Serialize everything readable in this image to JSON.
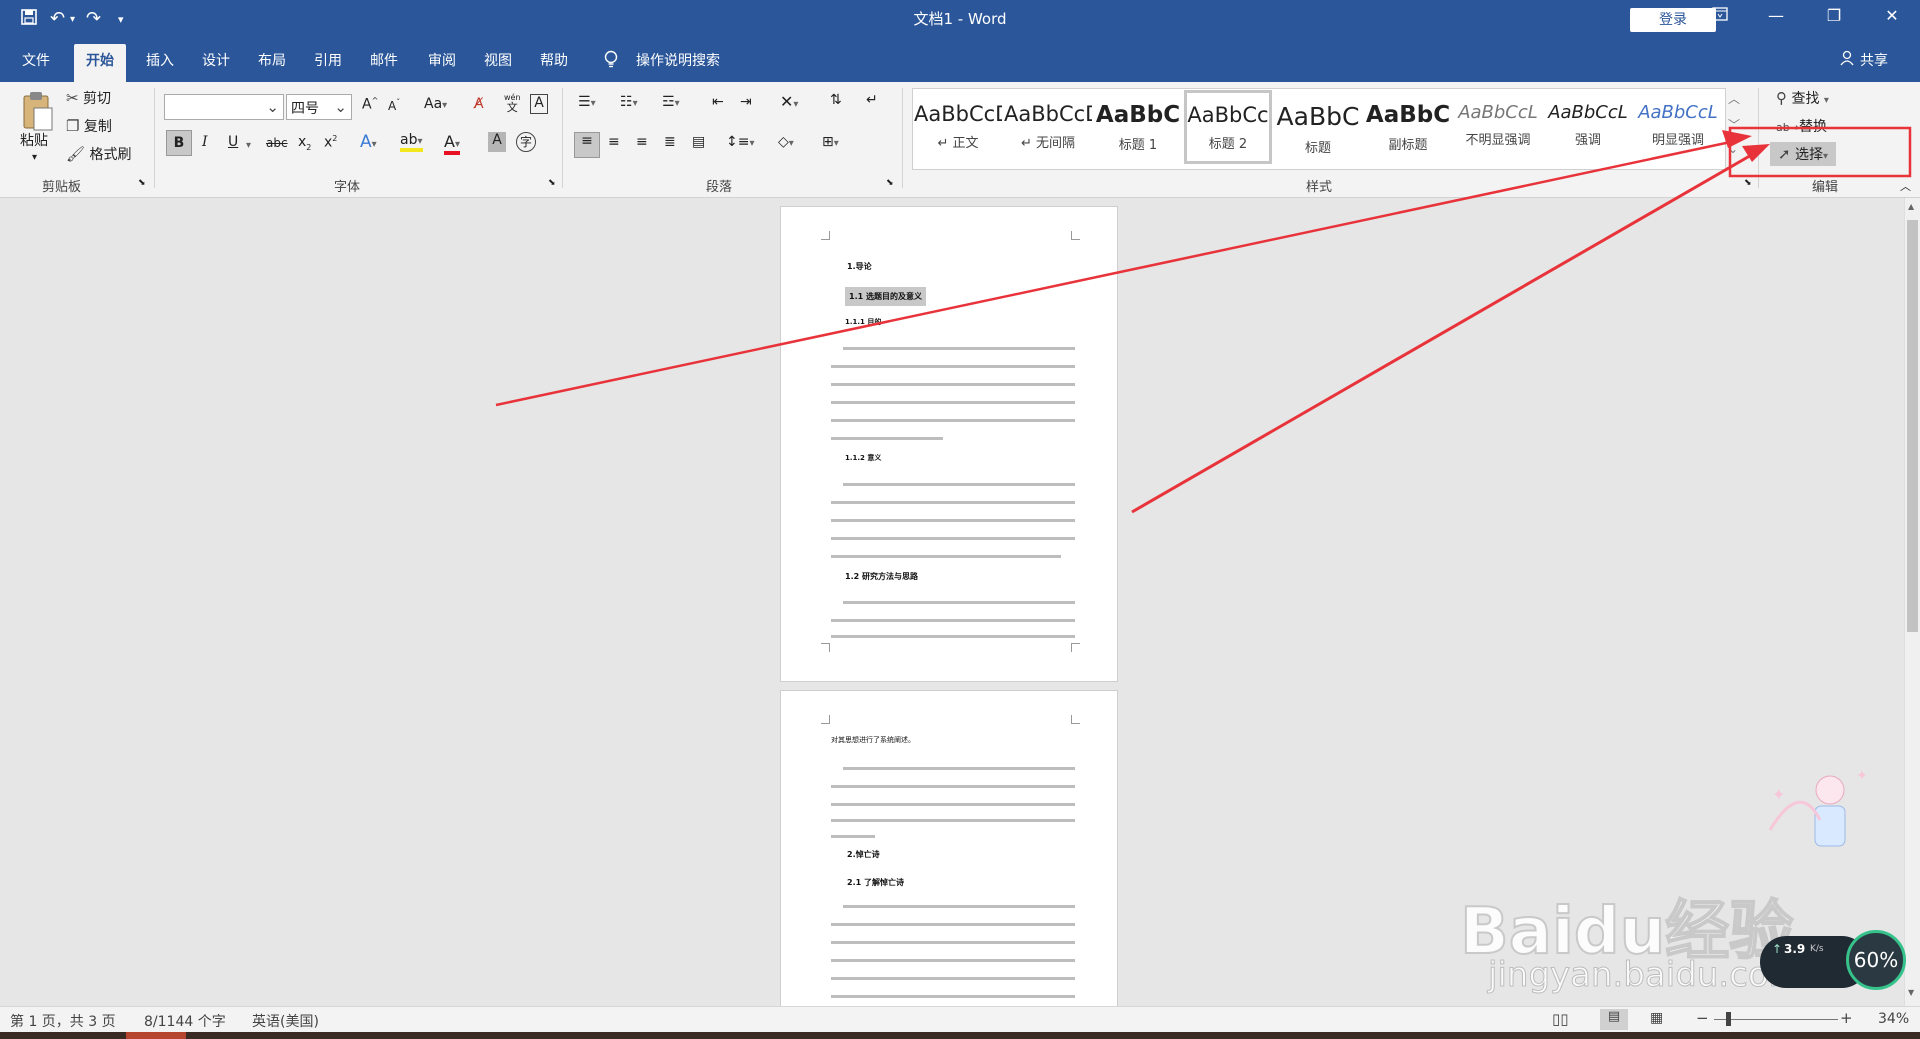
{
  "window": {
    "title": "文档1 - Word",
    "login": "登录"
  },
  "quick_access": {
    "save_icon": "save-icon",
    "undo_icon": "undo-icon",
    "redo_icon": "redo-icon",
    "customize_icon": "chevron-down-icon"
  },
  "menu": {
    "tabs": [
      "文件",
      "开始",
      "插入",
      "设计",
      "布局",
      "引用",
      "邮件",
      "审阅",
      "视图",
      "帮助"
    ],
    "tell_me": "操作说明搜索",
    "share": "共享"
  },
  "clipboard": {
    "paste": "粘贴",
    "cut": "剪切",
    "copy": "复制",
    "format_painter": "格式刷",
    "label": "剪贴板"
  },
  "font": {
    "name": "",
    "size": "四号",
    "case_label": "Aa",
    "label": "字体",
    "wen": "wén",
    "wen_char": "文"
  },
  "paragraph": {
    "label": "段落"
  },
  "styles": {
    "label": "样式",
    "items": [
      {
        "sample": "AaBbCcD",
        "name": "↵ 正文"
      },
      {
        "sample": "AaBbCcD",
        "name": "↵ 无间隔"
      },
      {
        "sample": "AaBbC",
        "name": "标题 1"
      },
      {
        "sample": "AaBbCc",
        "name": "标题 2"
      },
      {
        "sample": "AaBbC",
        "name": "标题"
      },
      {
        "sample": "AaBbC",
        "name": "副标题"
      },
      {
        "sample": "AaBbCcL",
        "name": "不明显强调"
      },
      {
        "sample": "AaBbCcL",
        "name": "强调"
      },
      {
        "sample": "AaBbCcL",
        "name": "明显强调"
      }
    ]
  },
  "editing": {
    "find": "查找",
    "replace": "替换",
    "select": "选择",
    "label": "编辑"
  },
  "document": {
    "page1": {
      "h1": "1.导论",
      "h2_selected": "1.1 选题目的及意义",
      "h3a": "1.1.1 目的",
      "h3b": "1.1.2 意义",
      "h2b": "1.2 研究方法与思路"
    },
    "page2": {
      "first_line": "对其思想进行了系统阐述。",
      "h1": "2.悼亡诗",
      "h2": "2.1 了解悼亡诗"
    }
  },
  "status": {
    "page": "第 1 页，共 3 页",
    "words": "8/1144 个字",
    "lang": "英语(美国)",
    "zoom": "34%"
  },
  "watermark": {
    "speed": "3.9",
    "speed_unit": "K/s",
    "percent": "60%",
    "brand": "Baidu经验",
    "url": "jingyan.baidu.com"
  },
  "colors": {
    "brand": "#2b579a",
    "annotation": "#e8333a"
  }
}
